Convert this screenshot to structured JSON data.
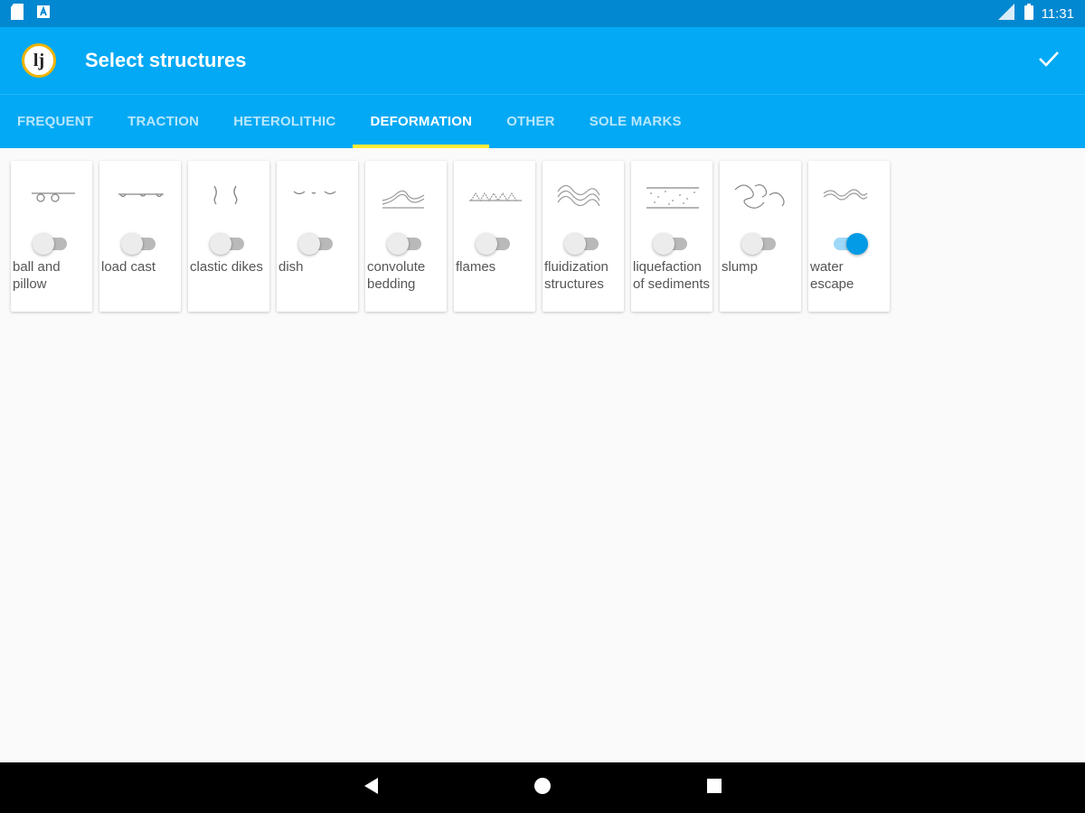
{
  "status_bar": {
    "time": "11:31",
    "icons": [
      "sim-card-icon",
      "keyboard-a-icon",
      "signal-icon",
      "battery-icon"
    ]
  },
  "app_bar": {
    "title": "Select structures",
    "logo_text": "lj",
    "confirm_icon": "check-icon",
    "background": "#03a9f4"
  },
  "tabs": [
    {
      "label": "FREQUENT",
      "active": false
    },
    {
      "label": "TRACTION",
      "active": false
    },
    {
      "label": "HETEROLITHIC",
      "active": false
    },
    {
      "label": "DEFORMATION",
      "active": true
    },
    {
      "label": "OTHER",
      "active": false
    },
    {
      "label": "SOLE MARKS",
      "active": false
    }
  ],
  "structures": [
    {
      "label": "ball and pillow",
      "icon": "ball-and-pillow-icon",
      "selected": false
    },
    {
      "label": "load cast",
      "icon": "load-cast-icon",
      "selected": false
    },
    {
      "label": "clastic dikes",
      "icon": "clastic-dikes-icon",
      "selected": false
    },
    {
      "label": "dish",
      "icon": "dish-icon",
      "selected": false
    },
    {
      "label": "convolute bedding",
      "icon": "convolute-bedding-icon",
      "selected": false
    },
    {
      "label": "flames",
      "icon": "flames-icon",
      "selected": false
    },
    {
      "label": "fluidization structures",
      "icon": "fluidization-structures-icon",
      "selected": false
    },
    {
      "label": "liquefaction of sediments",
      "icon": "liquefaction-of-sediments-icon",
      "selected": false
    },
    {
      "label": "slump",
      "icon": "slump-icon",
      "selected": false
    },
    {
      "label": "water escape",
      "icon": "water-escape-icon",
      "selected": true
    }
  ],
  "nav_bar": {
    "back_icon": "back-triangle-icon",
    "home_icon": "home-circle-icon",
    "recents_icon": "recents-square-icon"
  },
  "colors": {
    "status_bar": "#0288d1",
    "primary": "#03a9f4",
    "tab_indicator": "#ffeb3b",
    "switch_on": "#039be5"
  }
}
